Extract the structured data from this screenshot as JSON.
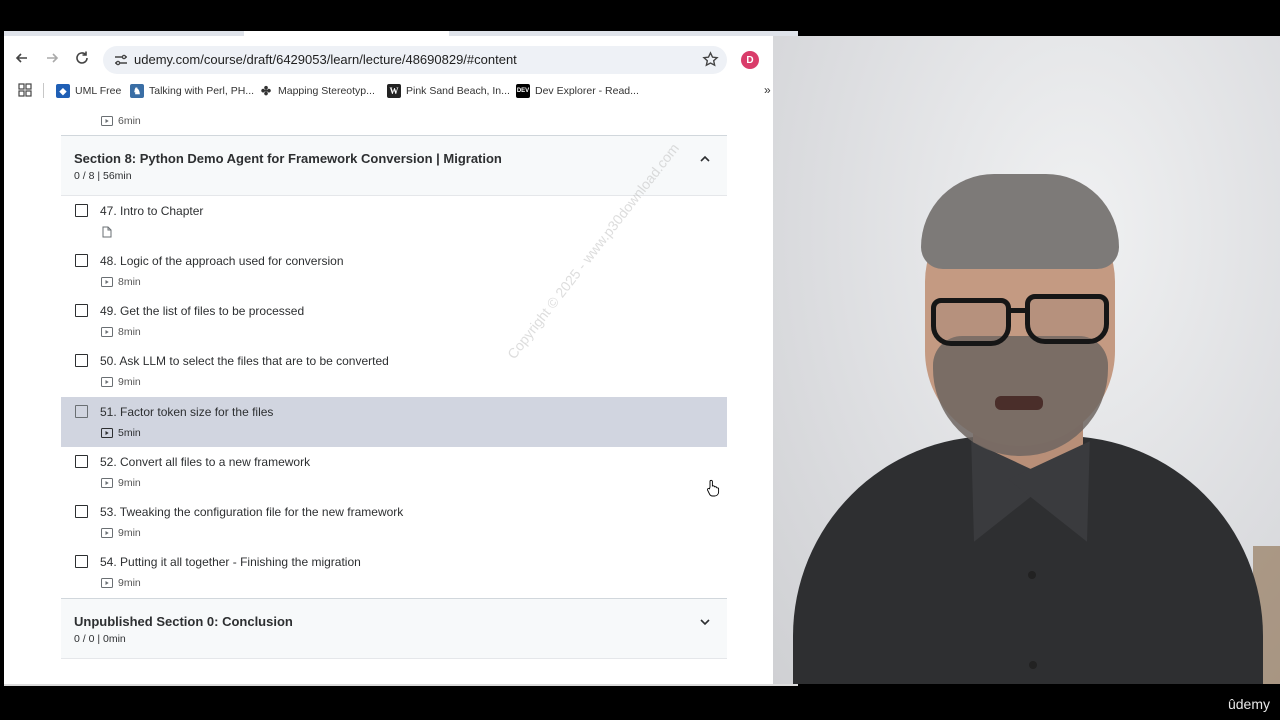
{
  "browser": {
    "url": "udemy.com/course/draft/6429053/learn/lecture/48690829/#content",
    "profile_initial": "D"
  },
  "bookmarks": [
    {
      "label": "UML Free",
      "icon": "uml-icon",
      "color": "#1f5fb5"
    },
    {
      "label": "Talking with Perl, PH...",
      "icon": "camel-icon",
      "color": "#3a6ea5"
    },
    {
      "label": "Mapping Stereotyp...",
      "icon": "deer-icon",
      "color": "#333333"
    },
    {
      "label": "Pink Sand Beach, In...",
      "icon": "wikipedia-icon",
      "color": "#222222"
    },
    {
      "label": "Dev Explorer - Read...",
      "icon": "dev-icon",
      "color": "#000000"
    }
  ],
  "previous_lecture": {
    "duration": "6min"
  },
  "section8": {
    "title": "Section 8: Python Demo Agent for Framework Conversion | Migration",
    "meta": "0 / 8 | 56min"
  },
  "lectures": [
    {
      "title": "47. Intro to Chapter",
      "type": "article",
      "duration": ""
    },
    {
      "title": "48. Logic of the approach used for conversion",
      "type": "video",
      "duration": "8min"
    },
    {
      "title": "49. Get the list of files to be processed",
      "type": "video",
      "duration": "8min"
    },
    {
      "title": "50. Ask LLM to select the files that are to be converted",
      "type": "video",
      "duration": "9min"
    },
    {
      "title": "51. Factor token size for the files",
      "type": "video",
      "duration": "5min",
      "active": true
    },
    {
      "title": "52. Convert all files to a new framework",
      "type": "video",
      "duration": "9min"
    },
    {
      "title": "53. Tweaking the configuration file for the new framework",
      "type": "video",
      "duration": "9min"
    },
    {
      "title": "54. Putting it all together - Finishing the migration",
      "type": "video",
      "duration": "9min"
    }
  ],
  "section_conclusion": {
    "title": "Unpublished Section 0: Conclusion",
    "meta": "0 / 0 | 0min"
  },
  "watermark": "Copyright © 2025 - www.p30download.com",
  "brand": "ûdemy"
}
